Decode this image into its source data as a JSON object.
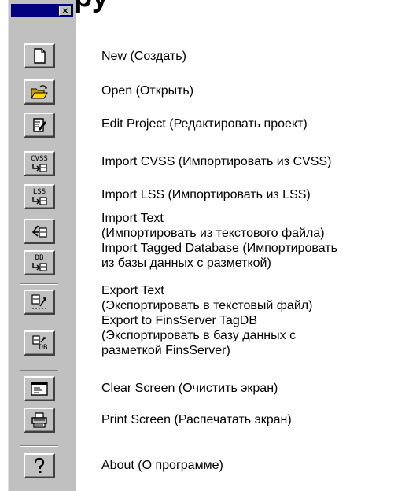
{
  "heading": "ру",
  "toolbar": {
    "close_label": "×",
    "buttons": [
      {
        "id": "new",
        "icon": "new-document-icon"
      },
      {
        "id": "open",
        "icon": "open-folder-icon"
      },
      {
        "id": "edit-project",
        "icon": "edit-document-icon"
      },
      {
        "id": "import-cvss",
        "icon": "import-cvss-icon",
        "icon_text": "CVSS"
      },
      {
        "id": "import-lss",
        "icon": "import-lss-icon",
        "icon_text": "LSS"
      },
      {
        "id": "import-text",
        "icon": "import-text-icon"
      },
      {
        "id": "import-tagged-db",
        "icon": "import-db-icon",
        "icon_text": "DB"
      },
      {
        "id": "export-text",
        "icon": "export-text-icon"
      },
      {
        "id": "export-finsserver",
        "icon": "export-db-icon",
        "icon_text": "DB"
      },
      {
        "id": "clear-screen",
        "icon": "clear-screen-icon"
      },
      {
        "id": "print-screen",
        "icon": "printer-icon"
      },
      {
        "id": "about",
        "icon": "help-icon",
        "icon_text": "?"
      }
    ]
  },
  "descriptions": [
    {
      "lines": [
        "New (Создать)"
      ]
    },
    {
      "lines": [
        "Open (Открыть)"
      ]
    },
    {
      "lines": [
        "Edit Project (Редактировать проект)"
      ]
    },
    {
      "lines": [
        "Import CVSS (Импортировать из CVSS)"
      ]
    },
    {
      "lines": [
        "Import LSS (Импортировать из LSS)"
      ]
    },
    {
      "lines": [
        "Import Text",
        "(Импортировать из текстового файла)"
      ]
    },
    {
      "lines": [
        "Import Tagged Database (Импортировать",
        "из базы данных с разметкой)"
      ]
    },
    {
      "lines": [
        "Export Text",
        "(Экспортировать в текстовый файл)"
      ]
    },
    {
      "lines": [
        "Export to FinsServer TagDB",
        "(Экспортировать в базу данных с",
        "разметкой FinsServer)"
      ]
    },
    {
      "lines": [
        "Clear Screen (Очистить экран)"
      ]
    },
    {
      "lines": [
        "Print Screen (Распечатать экран)"
      ]
    },
    {
      "lines": [
        "About (О программе)"
      ]
    }
  ]
}
